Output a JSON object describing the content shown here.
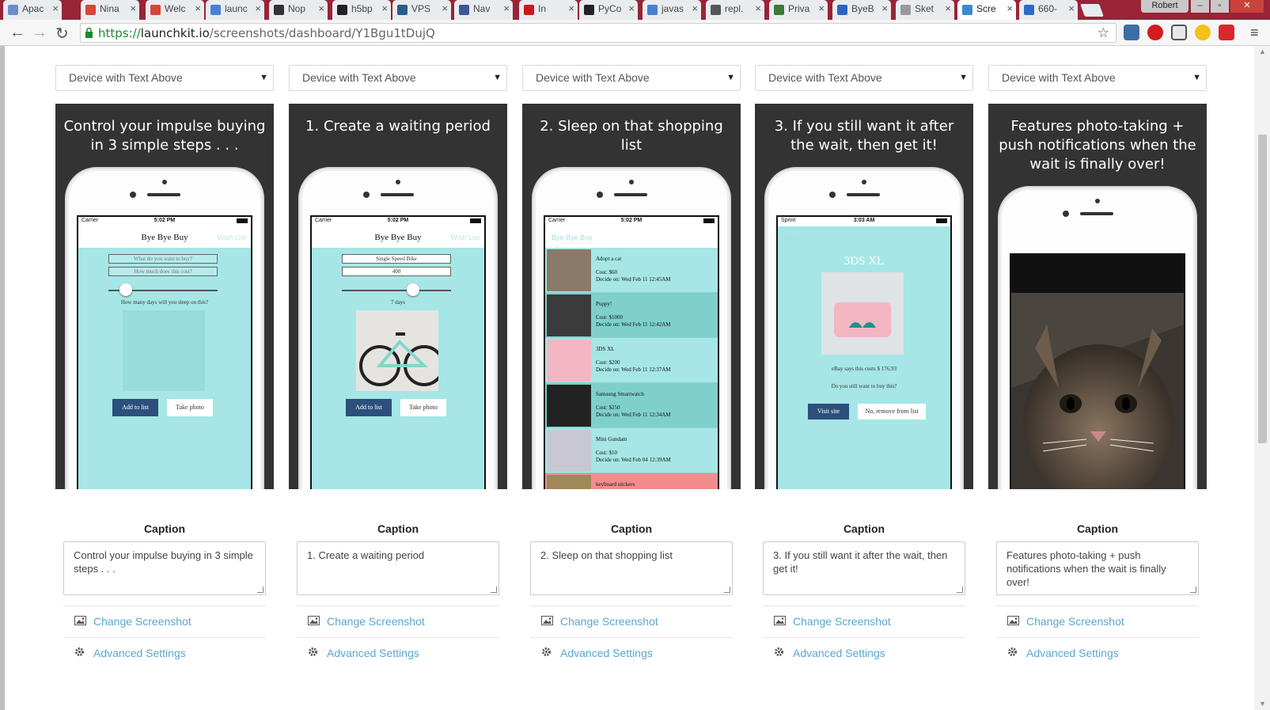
{
  "browser": {
    "tabs": [
      {
        "title": "Apac",
        "color": "#6b8ecb"
      },
      {
        "title": "Nina",
        "color": "#d44638"
      },
      {
        "title": "Welc",
        "color": "#d44638"
      },
      {
        "title": "launc",
        "color": "#4a7fd6"
      },
      {
        "title": "Nop",
        "color": "#333333"
      },
      {
        "title": "h5bp",
        "color": "#222222"
      },
      {
        "title": "VPS",
        "color": "#2a5a8c"
      },
      {
        "title": "Nav",
        "color": "#3b5998"
      },
      {
        "title": "In",
        "color": "#cc1818"
      },
      {
        "title": "PyCo",
        "color": "#222222"
      },
      {
        "title": "javas",
        "color": "#4a7fd6"
      },
      {
        "title": "repl.",
        "color": "#555555"
      },
      {
        "title": "Priva",
        "color": "#3a7a3a"
      },
      {
        "title": "ByeB",
        "color": "#2b66c2"
      },
      {
        "title": "Sket",
        "color": "#999999"
      },
      {
        "title": "Scre",
        "color": "#3a8ad0",
        "active": true
      },
      {
        "title": "660-",
        "color": "#2b6cc4"
      }
    ],
    "profile_name": "Robert",
    "url_secure": "https://",
    "url_host": "launchkit.io",
    "url_path": "/screenshots/dashboard/Y1Bgu1tDujQ"
  },
  "columns": [
    {
      "layout": "Device with Text Above",
      "headline": "Control your impulse buying in 3 simple steps . . .",
      "caption": "Control your impulse buying in 3 simple steps . . .",
      "change_label": "Change Screenshot",
      "advanced_label": "Advanced Settings"
    },
    {
      "layout": "Device with Text Above",
      "headline": "1. Create a waiting period",
      "caption": "1. Create a waiting period",
      "change_label": "Change Screenshot",
      "advanced_label": "Advanced Settings"
    },
    {
      "layout": "Device with Text Above",
      "headline": "2. Sleep on that shopping list",
      "caption": "2. Sleep on that shopping list",
      "change_label": "Change Screenshot",
      "advanced_label": "Advanced Settings"
    },
    {
      "layout": "Device with Text Above",
      "headline": "3. If you still want it after the wait, then get it!",
      "caption": "3. If you still want it after the wait, then get it!",
      "change_label": "Change Screenshot",
      "advanced_label": "Advanced Settings"
    },
    {
      "layout": "Device with Text Above",
      "headline": "Features photo-taking + push notifications when the wait is finally over!",
      "caption": "Features photo-taking + push notifications when the wait is finally over!",
      "change_label": "Change Screenshot",
      "advanced_label": "Advanced Settings"
    }
  ],
  "caption_label": "Caption",
  "app": {
    "carrier": "Carrier",
    "time": "5:02 PM",
    "title": "Bye Bye Buy",
    "wishlist": "Wish List",
    "placeholder_item": "What do you want to buy?",
    "placeholder_cost": "How much does this cost?",
    "sleep_question": "How many days will you sleep on this?",
    "add_button": "Add to list",
    "photo_button": "Take photo",
    "item_value": "Single Speed Bike",
    "cost_value": "400",
    "days_value": "7 days",
    "list_back": "Bye Bye Buy",
    "list_items": [
      {
        "name": "Adopt a cat",
        "cost": "Cost: $60",
        "decide": "Decide on: Wed Feb 11 12:45AM"
      },
      {
        "name": "Puppy!",
        "cost": "Cost: $1000",
        "decide": "Decide on: Wed Feb 11 12:42AM"
      },
      {
        "name": "3DS XL",
        "cost": "Cost: $200",
        "decide": "Decide on: Wed Feb 11 12:37AM"
      },
      {
        "name": "Samsung Smartwatch",
        "cost": "Cost: $250",
        "decide": "Decide on: Wed Feb 11 12:34AM"
      },
      {
        "name": "Mini Gundam",
        "cost": "Cost: $10",
        "decide": "Decide on: Wed Feb 04 12:39AM"
      },
      {
        "name": "keyboard stickers",
        "cost": "",
        "decide": ""
      }
    ],
    "detail_carrier": "Sprint",
    "detail_time": "3:03 AM",
    "detail_battery": "100%",
    "detail_back": "Back",
    "detail_title": "3DS XL",
    "ebay_text": "eBay says this costs $ 176.93",
    "still_want": "Do you still want to buy this?",
    "visit_button": "Visit site",
    "remove_button": "No, remove from list"
  }
}
